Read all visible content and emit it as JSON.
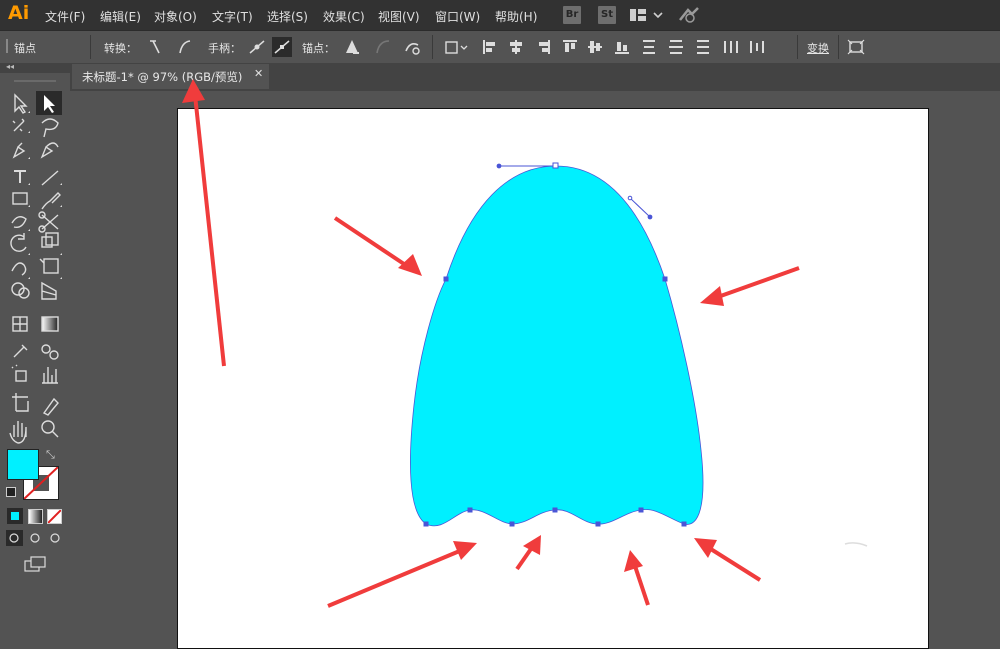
{
  "app": {
    "logo": "Ai",
    "accent": "#ff9a00"
  },
  "menubar": {
    "items": [
      "文件(F)",
      "编辑(E)",
      "对象(O)",
      "文字(T)",
      "选择(S)",
      "效果(C)",
      "视图(V)",
      "窗口(W)",
      "帮助(H)"
    ],
    "chips": [
      "Br",
      "St"
    ]
  },
  "controlbar": {
    "panel_label": "锚点",
    "convert_label": "转换：",
    "handles_label": "手柄：",
    "anchors_label": "锚点：",
    "transform_label": "变换"
  },
  "tab": {
    "title": "未标题-1* @ 97% (RGB/预览)",
    "close": "✕"
  },
  "colors": {
    "fill": "#00f0ff",
    "stroke": "none",
    "shape_fill": "#00f0ff",
    "arrow": "#f03c3c",
    "anchor": "#4a55d6"
  },
  "icons": {
    "selection": "selection-tool-icon",
    "direct_selection": "direct-selection-tool-icon",
    "magic_wand": "magic-wand-icon",
    "lasso": "lasso-icon",
    "pen": "pen-icon",
    "type": "type-icon",
    "zoom": "zoom-icon",
    "hand": "hand-icon"
  }
}
